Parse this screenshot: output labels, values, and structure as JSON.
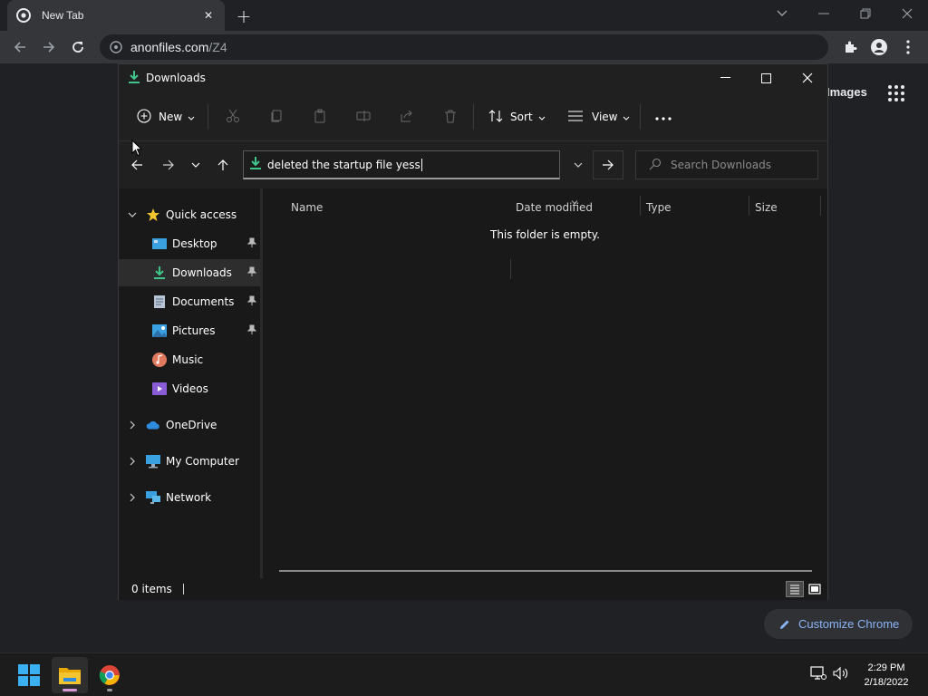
{
  "chrome": {
    "tab_title": "New Tab",
    "url_host": "anonfiles.com",
    "url_path": "/Z4",
    "images_link": "Images",
    "customize_label": "Customize Chrome"
  },
  "explorer": {
    "title": "Downloads",
    "commands": {
      "new": "New",
      "sort": "Sort",
      "view": "View"
    },
    "address_value": "deleted the startup file yess",
    "search_placeholder": "Search Downloads",
    "nav": {
      "quick_access": "Quick access",
      "desktop": "Desktop",
      "downloads": "Downloads",
      "documents": "Documents",
      "pictures": "Pictures",
      "music": "Music",
      "videos": "Videos",
      "onedrive": "OneDrive",
      "my_computer": "My Computer",
      "network": "Network"
    },
    "columns": {
      "name": "Name",
      "date_modified": "Date modified",
      "type": "Type",
      "size": "Size"
    },
    "empty_message": "This folder is empty.",
    "status_count": "0 items"
  },
  "taskbar": {
    "time": "2:29 PM",
    "date": "2/18/2022"
  },
  "colors": {
    "accent_green": "#3fc48a",
    "chrome_link": "#8ab4f8",
    "folder_yellow": "#f4c430"
  }
}
